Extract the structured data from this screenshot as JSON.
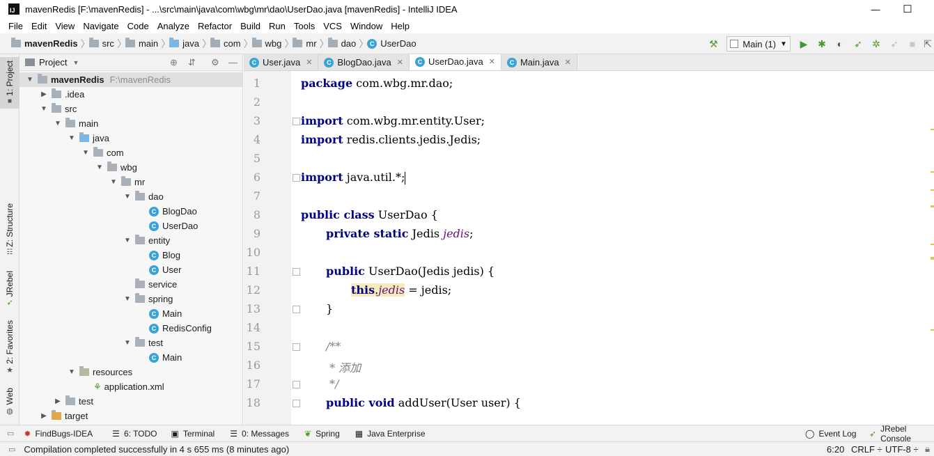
{
  "window": {
    "title": "mavenRedis [F:\\mavenRedis] - ...\\src\\main\\java\\com\\wbg\\mr\\dao\\UserDao.java [mavenRedis] - IntelliJ IDEA",
    "app_icon_text": "IJ",
    "minimize": "—",
    "maximize": "☐"
  },
  "menu": [
    "File",
    "Edit",
    "View",
    "Navigate",
    "Code",
    "Analyze",
    "Refactor",
    "Build",
    "Run",
    "Tools",
    "VCS",
    "Window",
    "Help"
  ],
  "breadcrumb": [
    "mavenRedis",
    "src",
    "main",
    "java",
    "com",
    "wbg",
    "mr",
    "dao",
    "UserDao"
  ],
  "toolbar": {
    "run_config": "Main (1)"
  },
  "left_strip": {
    "project": "1: Project",
    "structure": "Z: Structure",
    "jrebel": "JRebel",
    "favorites": "2: Favorites",
    "web": "Web"
  },
  "project_panel": {
    "title": "Project",
    "tree": [
      {
        "label": "mavenRedis",
        "suffix": "F:\\mavenRedis",
        "depth": 0,
        "arrow": "▼",
        "icon": "folder",
        "bold": true,
        "sel": true
      },
      {
        "label": ".idea",
        "depth": 1,
        "arrow": "▶",
        "icon": "folder"
      },
      {
        "label": "src",
        "depth": 1,
        "arrow": "▼",
        "icon": "folder"
      },
      {
        "label": "main",
        "depth": 2,
        "arrow": "▼",
        "icon": "folder"
      },
      {
        "label": "java",
        "depth": 3,
        "arrow": "▼",
        "icon": "folder-blue"
      },
      {
        "label": "com",
        "depth": 4,
        "arrow": "▼",
        "icon": "folder"
      },
      {
        "label": "wbg",
        "depth": 5,
        "arrow": "▼",
        "icon": "folder"
      },
      {
        "label": "mr",
        "depth": 6,
        "arrow": "▼",
        "icon": "folder"
      },
      {
        "label": "dao",
        "depth": 7,
        "arrow": "▼",
        "icon": "folder"
      },
      {
        "label": "BlogDao",
        "depth": 8,
        "arrow": "",
        "icon": "class"
      },
      {
        "label": "UserDao",
        "depth": 8,
        "arrow": "",
        "icon": "class"
      },
      {
        "label": "entity",
        "depth": 7,
        "arrow": "▼",
        "icon": "folder"
      },
      {
        "label": "Blog",
        "depth": 8,
        "arrow": "",
        "icon": "class"
      },
      {
        "label": "User",
        "depth": 8,
        "arrow": "",
        "icon": "class"
      },
      {
        "label": "service",
        "depth": 7,
        "arrow": "",
        "icon": "folder"
      },
      {
        "label": "spring",
        "depth": 7,
        "arrow": "▼",
        "icon": "folder"
      },
      {
        "label": "Main",
        "depth": 8,
        "arrow": "",
        "icon": "class-run"
      },
      {
        "label": "RedisConfig",
        "depth": 8,
        "arrow": "",
        "icon": "class"
      },
      {
        "label": "test",
        "depth": 7,
        "arrow": "▼",
        "icon": "folder"
      },
      {
        "label": "Main",
        "depth": 8,
        "arrow": "",
        "icon": "class-run"
      },
      {
        "label": "resources",
        "depth": 3,
        "arrow": "▼",
        "icon": "folder-res"
      },
      {
        "label": "application.xml",
        "depth": 4,
        "arrow": "",
        "icon": "xml"
      },
      {
        "label": "test",
        "depth": 2,
        "arrow": "▶",
        "icon": "folder"
      },
      {
        "label": "target",
        "depth": 1,
        "arrow": "▶",
        "icon": "folder-orange"
      }
    ]
  },
  "editor_tabs": [
    {
      "label": "User.java",
      "active": false
    },
    {
      "label": "BlogDao.java",
      "active": false
    },
    {
      "label": "UserDao.java",
      "active": true
    },
    {
      "label": "Main.java",
      "active": false
    }
  ],
  "code_lines": [
    "1",
    "2",
    "3",
    "4",
    "5",
    "6",
    "7",
    "8",
    "9",
    "10",
    "11",
    "12",
    "13",
    "14",
    "15",
    "16",
    "17",
    "18"
  ],
  "code": {
    "l1_kw": "package",
    "l1_rest": " com.wbg.mr.dao;",
    "l3_kw": "import",
    "l3_rest": " com.wbg.mr.entity.User;",
    "l4_kw": "import",
    "l4_rest": " redis.clients.jedis.Jedis;",
    "l6_kw": "import",
    "l6_rest": " java.util.*;",
    "l8_kw": "public class",
    "l8_rest": " UserDao {",
    "l9_kw": "private static",
    "l9_type": " Jedis ",
    "l9_fld": "jedis",
    "l9_end": ";",
    "l11_kw": "public",
    "l11_rest": " UserDao(Jedis jedis) {",
    "l12_kw": "this",
    "l12_dot": ".",
    "l12_fld": "jedis",
    "l12_rest": " = jedis;",
    "l13": "}",
    "l15": "/**",
    "l16": " * 添加",
    "l17": " */",
    "l18_kw": "public void",
    "l18_rest": " addUser(User user) {"
  },
  "bottom_tools": [
    "FindBugs-IDEA",
    "6: TODO",
    "Terminal",
    "0: Messages",
    "Spring",
    "Java Enterprise"
  ],
  "bottom_right_tools": [
    "Event Log",
    "JRebel Console"
  ],
  "status": {
    "message": "Compilation completed successfully in 4 s 655 ms (8 minutes ago)",
    "position": "6:20",
    "line_sep": "CRLF ÷",
    "encoding": "UTF-8 ÷"
  }
}
